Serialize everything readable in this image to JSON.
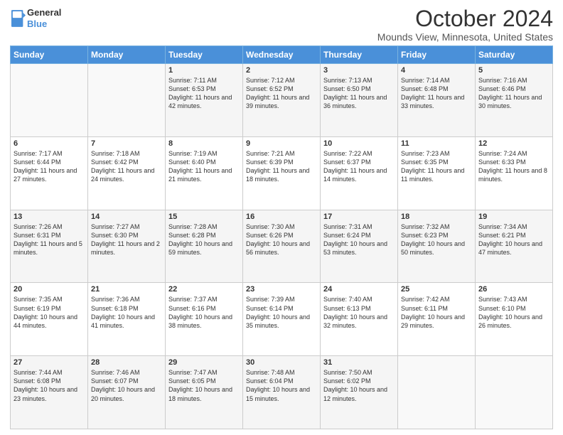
{
  "header": {
    "logo_general": "General",
    "logo_blue": "Blue",
    "title": "October 2024",
    "location": "Mounds View, Minnesota, United States"
  },
  "days_of_week": [
    "Sunday",
    "Monday",
    "Tuesday",
    "Wednesday",
    "Thursday",
    "Friday",
    "Saturday"
  ],
  "weeks": [
    [
      {
        "num": "",
        "info": ""
      },
      {
        "num": "",
        "info": ""
      },
      {
        "num": "1",
        "info": "Sunrise: 7:11 AM\nSunset: 6:53 PM\nDaylight: 11 hours and 42 minutes."
      },
      {
        "num": "2",
        "info": "Sunrise: 7:12 AM\nSunset: 6:52 PM\nDaylight: 11 hours and 39 minutes."
      },
      {
        "num": "3",
        "info": "Sunrise: 7:13 AM\nSunset: 6:50 PM\nDaylight: 11 hours and 36 minutes."
      },
      {
        "num": "4",
        "info": "Sunrise: 7:14 AM\nSunset: 6:48 PM\nDaylight: 11 hours and 33 minutes."
      },
      {
        "num": "5",
        "info": "Sunrise: 7:16 AM\nSunset: 6:46 PM\nDaylight: 11 hours and 30 minutes."
      }
    ],
    [
      {
        "num": "6",
        "info": "Sunrise: 7:17 AM\nSunset: 6:44 PM\nDaylight: 11 hours and 27 minutes."
      },
      {
        "num": "7",
        "info": "Sunrise: 7:18 AM\nSunset: 6:42 PM\nDaylight: 11 hours and 24 minutes."
      },
      {
        "num": "8",
        "info": "Sunrise: 7:19 AM\nSunset: 6:40 PM\nDaylight: 11 hours and 21 minutes."
      },
      {
        "num": "9",
        "info": "Sunrise: 7:21 AM\nSunset: 6:39 PM\nDaylight: 11 hours and 18 minutes."
      },
      {
        "num": "10",
        "info": "Sunrise: 7:22 AM\nSunset: 6:37 PM\nDaylight: 11 hours and 14 minutes."
      },
      {
        "num": "11",
        "info": "Sunrise: 7:23 AM\nSunset: 6:35 PM\nDaylight: 11 hours and 11 minutes."
      },
      {
        "num": "12",
        "info": "Sunrise: 7:24 AM\nSunset: 6:33 PM\nDaylight: 11 hours and 8 minutes."
      }
    ],
    [
      {
        "num": "13",
        "info": "Sunrise: 7:26 AM\nSunset: 6:31 PM\nDaylight: 11 hours and 5 minutes."
      },
      {
        "num": "14",
        "info": "Sunrise: 7:27 AM\nSunset: 6:30 PM\nDaylight: 11 hours and 2 minutes."
      },
      {
        "num": "15",
        "info": "Sunrise: 7:28 AM\nSunset: 6:28 PM\nDaylight: 10 hours and 59 minutes."
      },
      {
        "num": "16",
        "info": "Sunrise: 7:30 AM\nSunset: 6:26 PM\nDaylight: 10 hours and 56 minutes."
      },
      {
        "num": "17",
        "info": "Sunrise: 7:31 AM\nSunset: 6:24 PM\nDaylight: 10 hours and 53 minutes."
      },
      {
        "num": "18",
        "info": "Sunrise: 7:32 AM\nSunset: 6:23 PM\nDaylight: 10 hours and 50 minutes."
      },
      {
        "num": "19",
        "info": "Sunrise: 7:34 AM\nSunset: 6:21 PM\nDaylight: 10 hours and 47 minutes."
      }
    ],
    [
      {
        "num": "20",
        "info": "Sunrise: 7:35 AM\nSunset: 6:19 PM\nDaylight: 10 hours and 44 minutes."
      },
      {
        "num": "21",
        "info": "Sunrise: 7:36 AM\nSunset: 6:18 PM\nDaylight: 10 hours and 41 minutes."
      },
      {
        "num": "22",
        "info": "Sunrise: 7:37 AM\nSunset: 6:16 PM\nDaylight: 10 hours and 38 minutes."
      },
      {
        "num": "23",
        "info": "Sunrise: 7:39 AM\nSunset: 6:14 PM\nDaylight: 10 hours and 35 minutes."
      },
      {
        "num": "24",
        "info": "Sunrise: 7:40 AM\nSunset: 6:13 PM\nDaylight: 10 hours and 32 minutes."
      },
      {
        "num": "25",
        "info": "Sunrise: 7:42 AM\nSunset: 6:11 PM\nDaylight: 10 hours and 29 minutes."
      },
      {
        "num": "26",
        "info": "Sunrise: 7:43 AM\nSunset: 6:10 PM\nDaylight: 10 hours and 26 minutes."
      }
    ],
    [
      {
        "num": "27",
        "info": "Sunrise: 7:44 AM\nSunset: 6:08 PM\nDaylight: 10 hours and 23 minutes."
      },
      {
        "num": "28",
        "info": "Sunrise: 7:46 AM\nSunset: 6:07 PM\nDaylight: 10 hours and 20 minutes."
      },
      {
        "num": "29",
        "info": "Sunrise: 7:47 AM\nSunset: 6:05 PM\nDaylight: 10 hours and 18 minutes."
      },
      {
        "num": "30",
        "info": "Sunrise: 7:48 AM\nSunset: 6:04 PM\nDaylight: 10 hours and 15 minutes."
      },
      {
        "num": "31",
        "info": "Sunrise: 7:50 AM\nSunset: 6:02 PM\nDaylight: 10 hours and 12 minutes."
      },
      {
        "num": "",
        "info": ""
      },
      {
        "num": "",
        "info": ""
      }
    ]
  ],
  "accent_color": "#4a90d9"
}
